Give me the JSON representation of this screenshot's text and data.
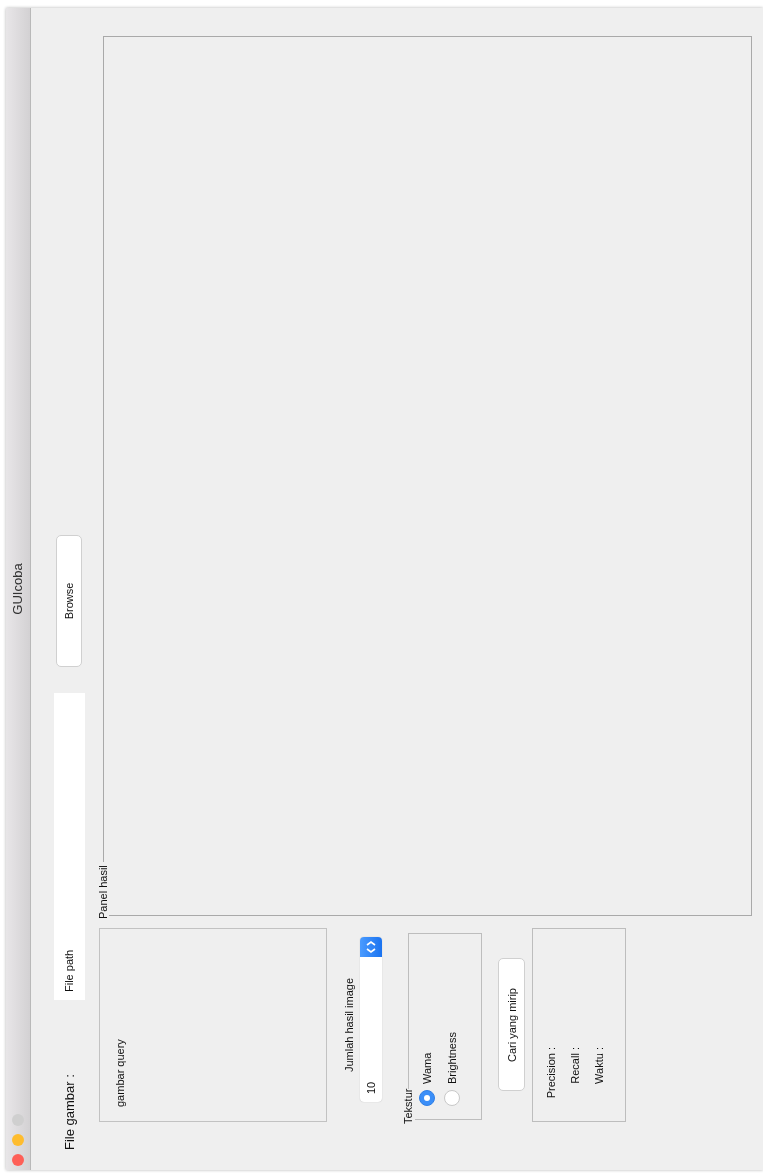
{
  "window": {
    "title": "GUIcoba"
  },
  "file": {
    "label": "File gambar :",
    "value": "File path",
    "button": "Browse"
  },
  "query_panel": {
    "label": "gambar query"
  },
  "result_panel": {
    "title": "Panel hasil"
  },
  "count": {
    "label": "Jumlah hasil image",
    "value": "10"
  },
  "texture": {
    "title": "Tekstur",
    "options": [
      {
        "label": "Wama",
        "selected": true
      },
      {
        "label": "Brightness",
        "selected": false
      }
    ]
  },
  "search_button": "Cari yang mirip",
  "metrics": [
    {
      "label": "Precision :"
    },
    {
      "label": "Recall :"
    },
    {
      "label": "Waktu :"
    }
  ]
}
